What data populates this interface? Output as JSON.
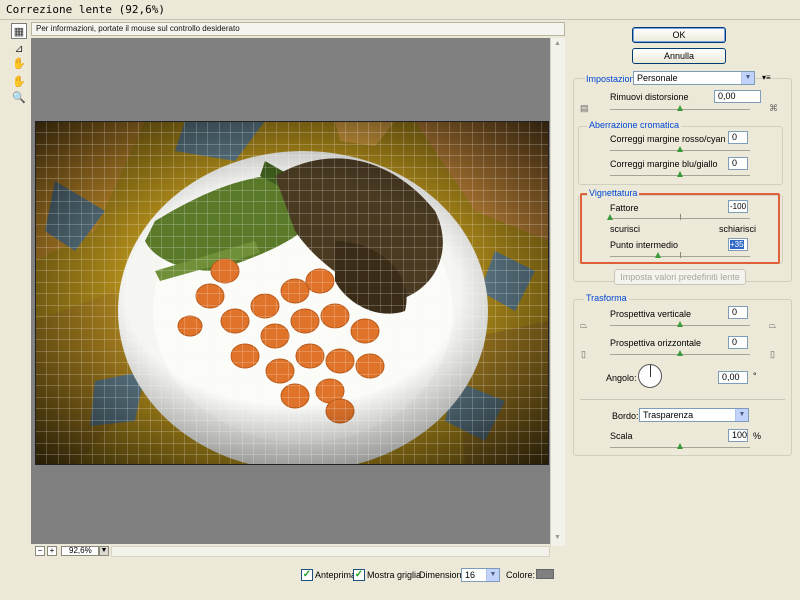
{
  "window": {
    "title": "Correzione lente (92,6%)"
  },
  "tools": [
    {
      "name": "remove-distortion-tool-icon",
      "glyph": "▦"
    },
    {
      "name": "straighten-tool-icon",
      "glyph": "⊿"
    },
    {
      "name": "move-grid-tool-icon",
      "glyph": "✋"
    },
    {
      "name": "hand-tool-icon",
      "glyph": "✋"
    },
    {
      "name": "zoom-tool-icon",
      "glyph": "🔍"
    }
  ],
  "infobar": {
    "text": "Per informazioni, portate il mouse sul controllo desiderato"
  },
  "zoom": {
    "minus": "−",
    "plus": "+",
    "value": "92,6%",
    "arrow": "▼"
  },
  "bottom": {
    "preview_label": "Anteprima",
    "grid_label": "Mostra griglia",
    "size_label": "Dimensione:",
    "size_value": "16",
    "color_label": "Colore:",
    "grid_color": "#808080"
  },
  "buttons": {
    "ok": "OK",
    "cancel": "Annulla",
    "lens_defaults": "Imposta valori predefiniti lente"
  },
  "settings": {
    "label": "Impostazioni:",
    "value": "Personale",
    "menu_icon": "▾≡"
  },
  "distortion": {
    "label": "Rimuovi distorsione",
    "value": "0,00"
  },
  "chromatic": {
    "title": "Aberrazione cromatica",
    "red_cyan_label": "Correggi margine rosso/cyan",
    "red_cyan_value": "0",
    "blue_yellow_label": "Correggi margine blu/giallo",
    "blue_yellow_value": "0"
  },
  "vignette": {
    "title": "Vignettatura",
    "amount_label": "Fattore",
    "amount_value": "-100",
    "darken_label": "scurisci",
    "lighten_label": "schiarisci",
    "midpoint_label": "Punto intermedio",
    "midpoint_value": "+35"
  },
  "transform": {
    "title": "Trasforma",
    "vertical_label": "Prospettiva verticale",
    "vertical_value": "0",
    "horizontal_label": "Prospettiva orizzontale",
    "horizontal_value": "0",
    "angle_label": "Angolo:",
    "angle_value": "0,00",
    "angle_unit": "°",
    "edge_label": "Bordo:",
    "edge_value": "Trasparenza",
    "scale_label": "Scala",
    "scale_value": "100",
    "scale_unit": "%"
  },
  "colors": {
    "accent": "#0046d5",
    "highlight": "#e0603a",
    "slider_thumb": "#3a9a3a"
  }
}
